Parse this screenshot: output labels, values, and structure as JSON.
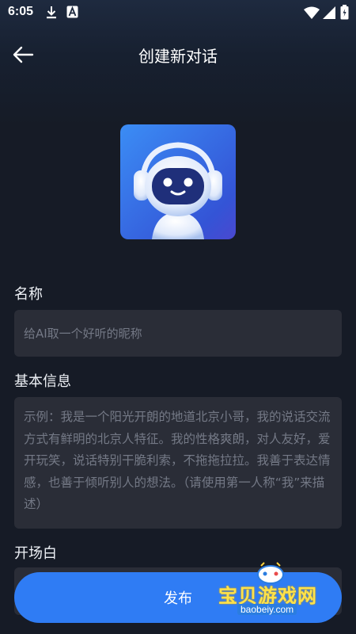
{
  "status_bar": {
    "time": "6:05",
    "icons": [
      "download-icon",
      "a-badge-icon",
      "wifi-icon",
      "signal-icon",
      "battery-icon"
    ]
  },
  "header": {
    "title": "创建新对话",
    "back_icon": "arrow-left-icon"
  },
  "avatar": {
    "icon": "robot-headphones-icon"
  },
  "form": {
    "name_label": "名称",
    "name_placeholder": "给AI取一个好听的昵称",
    "info_label": "基本信息",
    "info_placeholder": "示例：我是一个阳光开朗的地道北京小哥，我的说话交流方式有鲜明的北京人特征。我的性格爽朗，对人友好，爱开玩笑，说话特别干脆利索，不拖拖拉拉。我善于表达情感，也善于倾听别人的想法。（请使用第一人称“我”来描述）",
    "opening_label": "开场白"
  },
  "publish_button": {
    "label": "发布"
  },
  "watermark": {
    "text": "宝贝游戏网",
    "url": "baobeiy.com"
  },
  "colors": {
    "accent": "#2f7cf4",
    "background": "#161b26",
    "field": "#2a2d37"
  }
}
